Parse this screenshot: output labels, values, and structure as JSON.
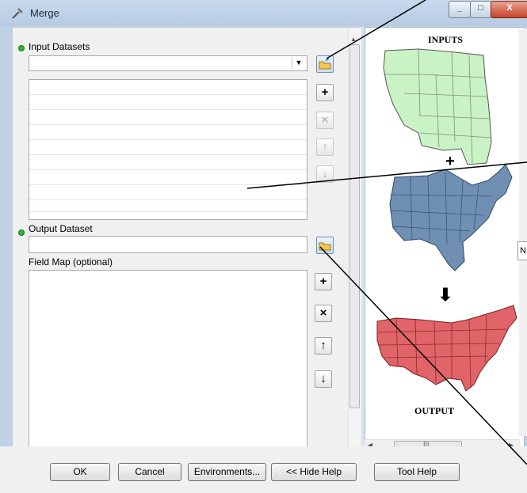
{
  "window": {
    "title": "Merge"
  },
  "form": {
    "input_label": "Input Datasets",
    "input_value": "",
    "output_label": "Output Dataset",
    "output_value": "",
    "fieldmap_label": "Field Map (optional)"
  },
  "side_buttons": {
    "add": "+",
    "remove": "×",
    "up": "↑",
    "down": "↓",
    "fm_add": "+",
    "fm_remove": "×",
    "fm_up": "↑",
    "fm_down": "↓"
  },
  "help": {
    "inputs_heading": "INPUTS",
    "output_heading": "OUTPUT",
    "scroll_grip": "III",
    "edge_tab": "N",
    "colors": {
      "west": "#c9f3c4",
      "east": "#6f8fb3",
      "output": "#e06468"
    }
  },
  "buttons": {
    "ok": "OK",
    "cancel": "Cancel",
    "environments": "Environments...",
    "hide_help": "<< Hide Help",
    "tool_help": "Tool Help"
  }
}
